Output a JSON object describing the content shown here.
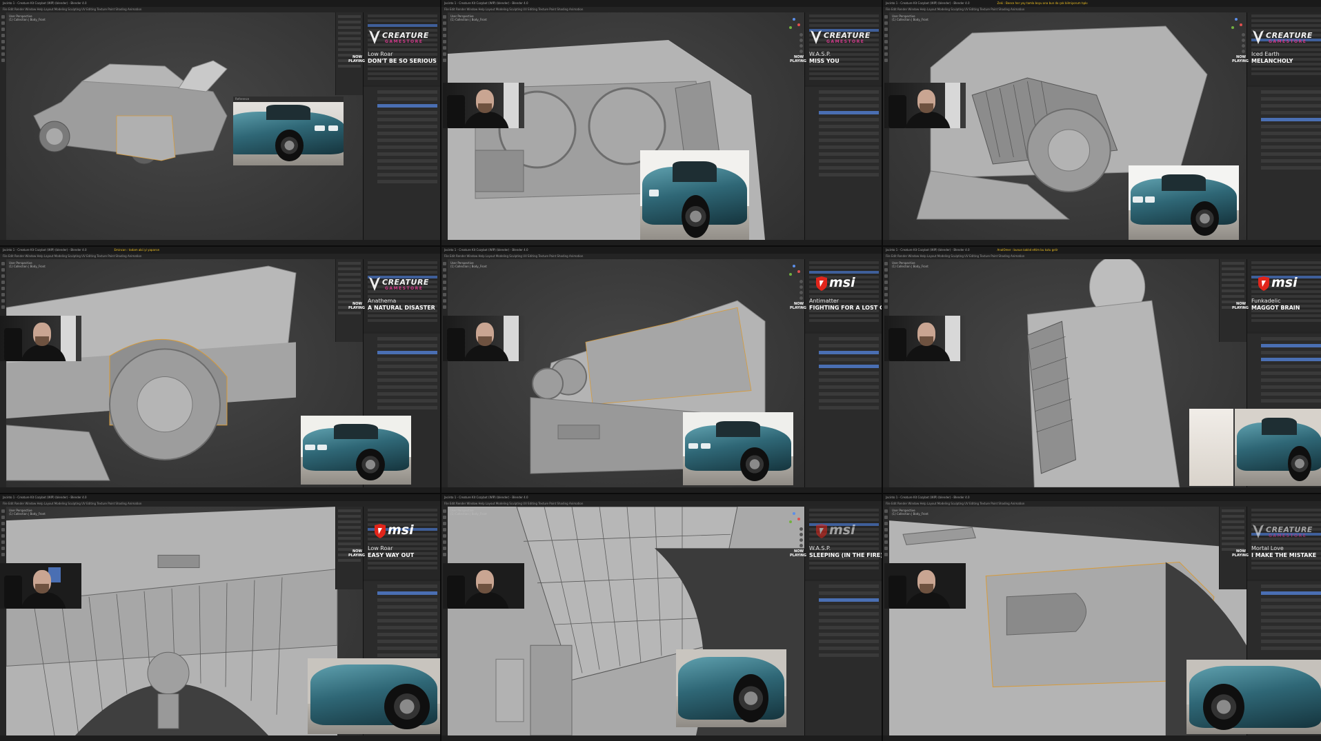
{
  "window": {
    "title": "Jacinto 1 - Creature Kit Cozybot (WIP) (blender) - Blender 4.0",
    "menu": "File  Edit  Render  Window  Help    Layout  Modeling  Sculpting  UV Editing  Texture Paint  Shading  Animation"
  },
  "viewport": {
    "mode": "User Perspective",
    "collection": "(1) Collection | Body_Front"
  },
  "now_playing_label": "NOW PLAYING",
  "reference_title": "Reference",
  "panels": [
    {
      "sponsor": "creature",
      "artist": "Low Roar",
      "title": "Don't Be So Serious",
      "alert": ""
    },
    {
      "sponsor": "creature",
      "artist": "W.A.S.P.",
      "title": "Miss You",
      "alert": ""
    },
    {
      "sponsor": "creature",
      "artist": "Iced Earth",
      "title": "Melancholy",
      "alert": "Zeki : Beece her yay tamla boyu ana bun da çok bilmiyorum tıpkı"
    },
    {
      "sponsor": "creature",
      "artist": "Anathema",
      "title": "A Natural Disaster",
      "alert": "Emincan : tadam abi iyi yaparsın"
    },
    {
      "sponsor": "msi",
      "artist": "Antimatter",
      "title": "Fighting For A Lost Cause",
      "alert": ""
    },
    {
      "sponsor": "msi",
      "artist": "Funkadelic",
      "title": "Maggot Brain",
      "alert": "AnalOmer : bunun kaklıd ettim bu kutu gelir"
    },
    {
      "sponsor": "msi",
      "artist": "Low Roar",
      "title": "Easy Way Out",
      "alert": ""
    },
    {
      "sponsor": "msi",
      "artist": "W.A.S.P.",
      "title": "Sleeping (In The Fire)",
      "alert": ""
    },
    {
      "sponsor": "creature",
      "artist": "Mortal Love",
      "title": "I Make The Mistake",
      "alert": ""
    }
  ],
  "logos": {
    "creature_line1": "CREATURE",
    "creature_line2": "GAMESTORE",
    "msi": "msi"
  },
  "colors": {
    "blender_bg": "#303030",
    "selection_blue": "#4a6fb3",
    "creature_accent": "#d03a8a",
    "msi_red": "#e1251b",
    "car_paint": "#2f6776"
  }
}
